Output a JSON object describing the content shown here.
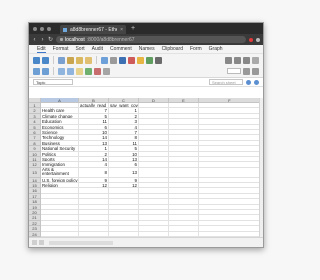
{
  "browser": {
    "tab_title": "a8d8brenner67 - EtherCalc",
    "tab_close": "×",
    "new_tab": "+",
    "url_host": "localhost",
    "url_path": ":8000/a8d8brenner67"
  },
  "menu": [
    "Edit",
    "Format",
    "Sort",
    "Audit",
    "Comment",
    "Names",
    "Clipboard",
    "Form",
    "Graph"
  ],
  "formula_bar": {
    "cell_ref": "Topic",
    "search_placeholder": "Search sheet"
  },
  "colors": {
    "accent": "#3c77c9",
    "header_bg": "#dcdcdc",
    "tab_bar": "#2b2b2b"
  },
  "sheet": {
    "columns": [
      "A",
      "B",
      "C",
      "D",
      "E",
      "F"
    ],
    "rows": [
      {
        "n": "1",
        "a": "",
        "b": "actually_read",
        "c": "say_want_covered"
      },
      {
        "n": "2",
        "a": "Health care",
        "b": "7",
        "c": "1"
      },
      {
        "n": "3",
        "a": "Climate change",
        "b": "5",
        "c": "2"
      },
      {
        "n": "4",
        "a": "Education",
        "b": "11",
        "c": "3"
      },
      {
        "n": "5",
        "a": "Economics",
        "b": "6",
        "c": "4"
      },
      {
        "n": "6",
        "a": "Science",
        "b": "10",
        "c": "7"
      },
      {
        "n": "7",
        "a": "Technology",
        "b": "14",
        "c": "8"
      },
      {
        "n": "8",
        "a": "Business",
        "b": "13",
        "c": "11"
      },
      {
        "n": "9",
        "a": "National Security",
        "b": "1",
        "c": "5"
      },
      {
        "n": "10",
        "a": "Politics",
        "b": "2",
        "c": "10"
      },
      {
        "n": "11",
        "a": "Sports",
        "b": "14",
        "c": "13"
      },
      {
        "n": "12",
        "a": "Immigration",
        "b": "4",
        "c": "6"
      },
      {
        "n": "13",
        "a": "Arts & entertainment",
        "b": "8",
        "c": "13"
      },
      {
        "n": "14",
        "a": "U.S. foreign policy",
        "b": "9",
        "c": "9"
      },
      {
        "n": "15",
        "a": "Religion",
        "b": "12",
        "c": "12"
      },
      {
        "n": "16",
        "a": "",
        "b": "",
        "c": ""
      },
      {
        "n": "17",
        "a": "",
        "b": "",
        "c": ""
      },
      {
        "n": "18",
        "a": "",
        "b": "",
        "c": ""
      },
      {
        "n": "19",
        "a": "",
        "b": "",
        "c": ""
      },
      {
        "n": "20",
        "a": "",
        "b": "",
        "c": ""
      },
      {
        "n": "21",
        "a": "",
        "b": "",
        "c": ""
      },
      {
        "n": "22",
        "a": "",
        "b": "",
        "c": ""
      },
      {
        "n": "23",
        "a": "",
        "b": "",
        "c": ""
      },
      {
        "n": "24",
        "a": "",
        "b": "",
        "c": ""
      },
      {
        "n": "25",
        "a": "",
        "b": "",
        "c": ""
      }
    ]
  }
}
